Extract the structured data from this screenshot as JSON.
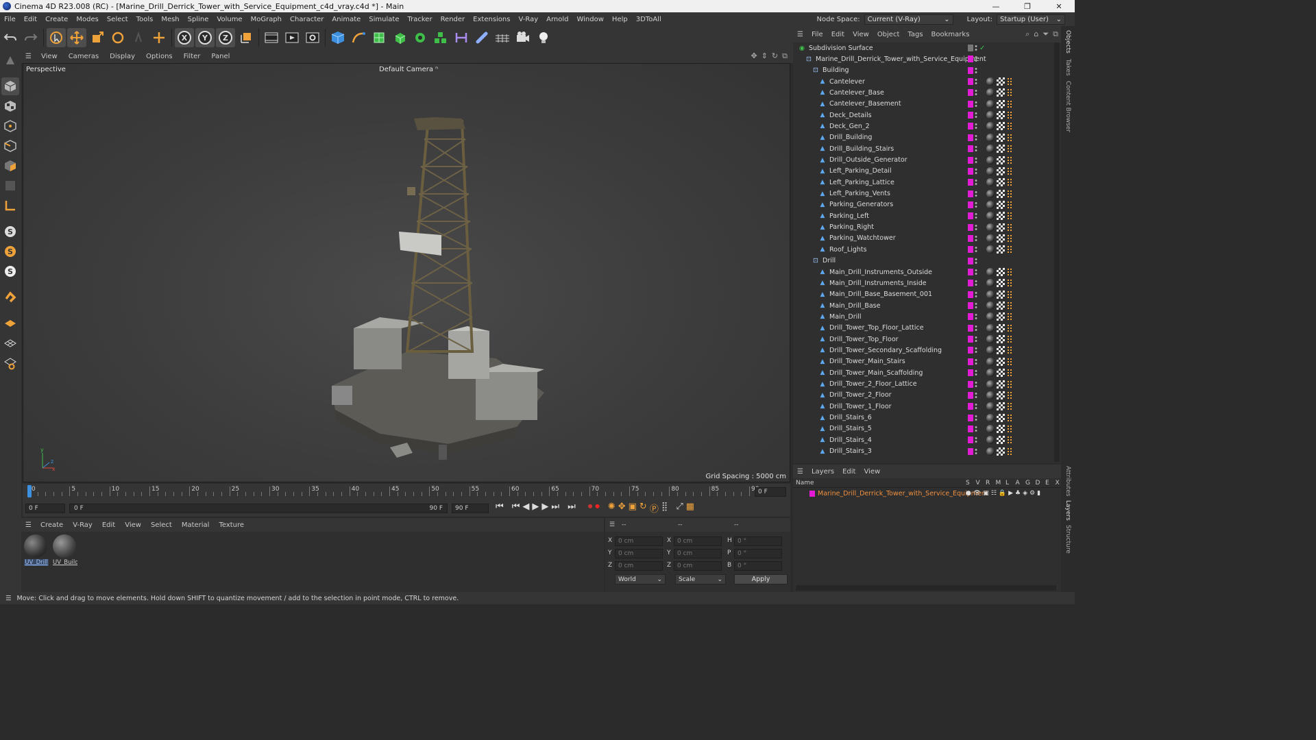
{
  "window": {
    "title": "Cinema 4D R23.008 (RC) - [Marine_Drill_Derrick_Tower_with_Service_Equipment_c4d_vray.c4d *] - Main"
  },
  "menubar": {
    "items": [
      "File",
      "Edit",
      "Create",
      "Modes",
      "Select",
      "Tools",
      "Mesh",
      "Spline",
      "Volume",
      "MoGraph",
      "Character",
      "Animate",
      "Simulate",
      "Tracker",
      "Render",
      "Extensions",
      "V-Ray",
      "Arnold",
      "Window",
      "Help",
      "3DToAll"
    ],
    "node_space_label": "Node Space:",
    "node_space_value": "Current (V-Ray)",
    "layout_label": "Layout:",
    "layout_value": "Startup (User)"
  },
  "viewport": {
    "menu": [
      "View",
      "Cameras",
      "Display",
      "Options",
      "Filter",
      "Panel"
    ],
    "label": "Perspective",
    "camera": "Default Camera",
    "grid_spacing": "Grid Spacing : 5000 cm"
  },
  "timeline": {
    "ticks": [
      "0",
      "5",
      "10",
      "15",
      "20",
      "25",
      "30",
      "35",
      "40",
      "45",
      "50",
      "55",
      "60",
      "65",
      "70",
      "75",
      "80",
      "85",
      "90"
    ],
    "end_frame": "0 F",
    "start_field": "0 F",
    "range_start": "0 F",
    "range_end": "90 F",
    "max_field": "90 F"
  },
  "materials": {
    "menu": [
      "Create",
      "V-Ray",
      "Edit",
      "View",
      "Select",
      "Material",
      "Texture"
    ],
    "items": [
      {
        "label": "UV_Drill"
      },
      {
        "label": "UV_Build"
      }
    ]
  },
  "coords": {
    "header": [
      "--",
      "--",
      "--"
    ],
    "rows": [
      {
        "a": "X",
        "av": "0 cm",
        "b": "X",
        "bv": "0 cm",
        "c": "H",
        "cv": "0 °"
      },
      {
        "a": "Y",
        "av": "0 cm",
        "b": "Y",
        "bv": "0 cm",
        "c": "P",
        "cv": "0 °"
      },
      {
        "a": "Z",
        "av": "0 cm",
        "b": "Z",
        "bv": "0 cm",
        "c": "B",
        "cv": "0 °"
      }
    ],
    "world": "World",
    "scale": "Scale",
    "apply": "Apply"
  },
  "objects": {
    "menu": [
      "File",
      "Edit",
      "View",
      "Object",
      "Tags",
      "Bookmarks"
    ],
    "rows": [
      {
        "name": "Subdivision Surface",
        "indent": 0,
        "kind": "subdiv"
      },
      {
        "name": "Marine_Drill_Derrick_Tower_with_Service_Equipment",
        "indent": 1,
        "kind": "null"
      },
      {
        "name": "Building",
        "indent": 2,
        "kind": "null"
      },
      {
        "name": "Cantelever",
        "indent": 3,
        "kind": "mesh"
      },
      {
        "name": "Cantelever_Base",
        "indent": 3,
        "kind": "mesh"
      },
      {
        "name": "Cantelever_Basement",
        "indent": 3,
        "kind": "mesh"
      },
      {
        "name": "Deck_Details",
        "indent": 3,
        "kind": "mesh"
      },
      {
        "name": "Deck_Gen_2",
        "indent": 3,
        "kind": "mesh"
      },
      {
        "name": "Drill_Building",
        "indent": 3,
        "kind": "mesh"
      },
      {
        "name": "Drill_Building_Stairs",
        "indent": 3,
        "kind": "mesh"
      },
      {
        "name": "Drill_Outside_Generator",
        "indent": 3,
        "kind": "mesh"
      },
      {
        "name": "Left_Parking_Detail",
        "indent": 3,
        "kind": "mesh"
      },
      {
        "name": "Left_Parking_Lattice",
        "indent": 3,
        "kind": "mesh"
      },
      {
        "name": "Left_Parking_Vents",
        "indent": 3,
        "kind": "mesh"
      },
      {
        "name": "Parking_Generators",
        "indent": 3,
        "kind": "mesh"
      },
      {
        "name": "Parking_Left",
        "indent": 3,
        "kind": "mesh"
      },
      {
        "name": "Parking_Right",
        "indent": 3,
        "kind": "mesh"
      },
      {
        "name": "Parking_Watchtower",
        "indent": 3,
        "kind": "mesh"
      },
      {
        "name": "Roof_Lights",
        "indent": 3,
        "kind": "mesh"
      },
      {
        "name": "Drill",
        "indent": 2,
        "kind": "null"
      },
      {
        "name": "Main_Drill_Instruments_Outside",
        "indent": 3,
        "kind": "mesh"
      },
      {
        "name": "Main_Drill_Instruments_Inside",
        "indent": 3,
        "kind": "mesh"
      },
      {
        "name": "Main_Drill_Base_Basement_001",
        "indent": 3,
        "kind": "mesh"
      },
      {
        "name": "Main_Drill_Base",
        "indent": 3,
        "kind": "mesh"
      },
      {
        "name": "Main_Drill",
        "indent": 3,
        "kind": "mesh"
      },
      {
        "name": "Drill_Tower_Top_Floor_Lattice",
        "indent": 3,
        "kind": "mesh"
      },
      {
        "name": "Drill_Tower_Top_Floor",
        "indent": 3,
        "kind": "mesh"
      },
      {
        "name": "Drill_Tower_Secondary_Scaffolding",
        "indent": 3,
        "kind": "mesh"
      },
      {
        "name": "Drill_Tower_Main_Stairs",
        "indent": 3,
        "kind": "mesh"
      },
      {
        "name": "Drill_Tower_Main_Scaffolding",
        "indent": 3,
        "kind": "mesh"
      },
      {
        "name": "Drill_Tower_2_Floor_Lattice",
        "indent": 3,
        "kind": "mesh"
      },
      {
        "name": "Drill_Tower_2_Floor",
        "indent": 3,
        "kind": "mesh"
      },
      {
        "name": "Drill_Tower_1_Floor",
        "indent": 3,
        "kind": "mesh"
      },
      {
        "name": "Drill_Stairs_6",
        "indent": 3,
        "kind": "mesh"
      },
      {
        "name": "Drill_Stairs_5",
        "indent": 3,
        "kind": "mesh"
      },
      {
        "name": "Drill_Stairs_4",
        "indent": 3,
        "kind": "mesh"
      },
      {
        "name": "Drill_Stairs_3",
        "indent": 3,
        "kind": "mesh"
      }
    ]
  },
  "layers": {
    "menu": [
      "Layers",
      "Edit",
      "View"
    ],
    "name_header": "Name",
    "col_headers": [
      "S",
      "V",
      "R",
      "M",
      "L",
      "A",
      "G",
      "D",
      "E",
      "X"
    ],
    "row_name": "Marine_Drill_Derrick_Tower_with_Service_Equipment",
    "row_color": "#e21bd5"
  },
  "side_tabs": [
    "Objects",
    "Takes",
    "Content Browser",
    "Attributes",
    "Layers",
    "Structure"
  ],
  "status": "Move: Click and drag to move elements. Hold down SHIFT to quantize movement / add to the selection in point mode, CTRL to remove.",
  "colors": {
    "accent": "#e21bd5",
    "orange": "#f0a23a",
    "highlight_text": "#f09040"
  }
}
